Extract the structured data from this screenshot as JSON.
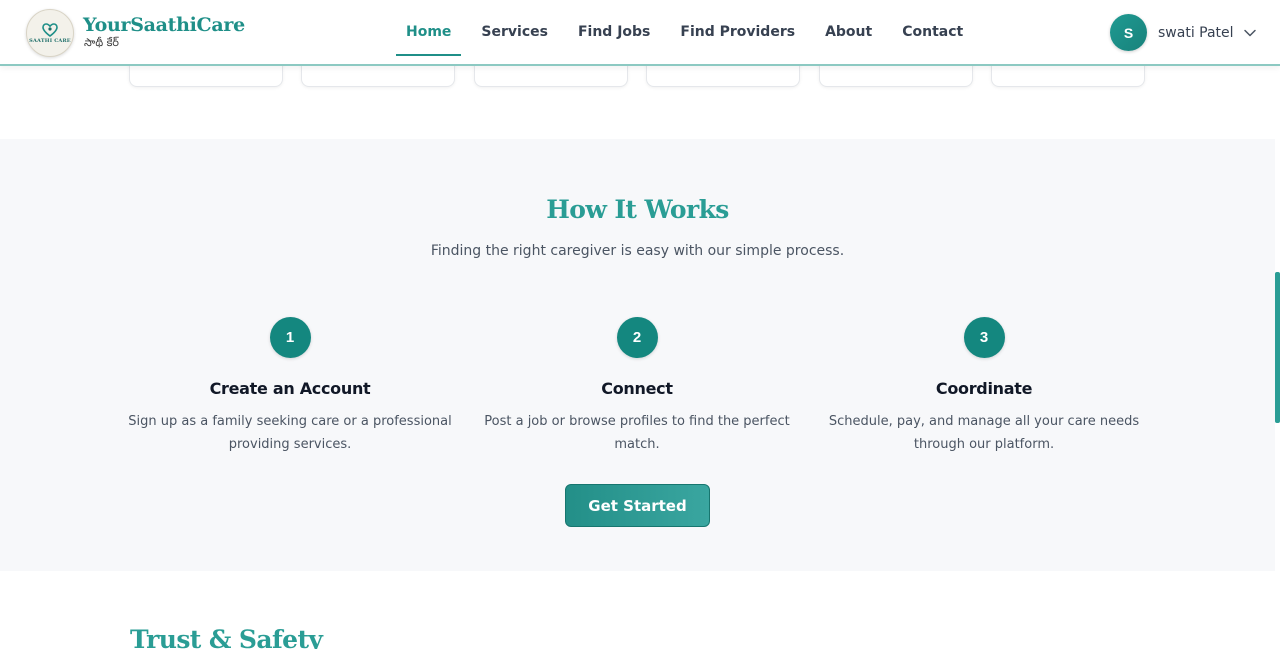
{
  "brand": {
    "name": "YourSaathiCare",
    "tagline": "సాథీ కేర్",
    "logo_text": "SAATHI CARE"
  },
  "nav": {
    "items": [
      {
        "label": "Home",
        "active": true
      },
      {
        "label": "Services"
      },
      {
        "label": "Find Jobs"
      },
      {
        "label": "Find Providers"
      },
      {
        "label": "About"
      },
      {
        "label": "Contact"
      }
    ]
  },
  "user": {
    "initial": "S",
    "name": "swati Patel"
  },
  "how_it_works": {
    "title": "How It Works",
    "subtitle": "Finding the right caregiver is easy with our simple process.",
    "steps": [
      {
        "number": "1",
        "title": "Create an Account",
        "description": "Sign up as a family seeking care or a professional providing services."
      },
      {
        "number": "2",
        "title": "Connect",
        "description": "Post a job or browse profiles to find the perfect match."
      },
      {
        "number": "3",
        "title": "Coordinate",
        "description": "Schedule, pay, and manage all your care needs through our platform."
      }
    ],
    "cta_label": "Get Started"
  },
  "trust": {
    "title": "Trust & Safety"
  },
  "colors": {
    "accent": "#1f8f88",
    "step_circle": "#14877f",
    "section_bg": "#f7f8fa"
  }
}
